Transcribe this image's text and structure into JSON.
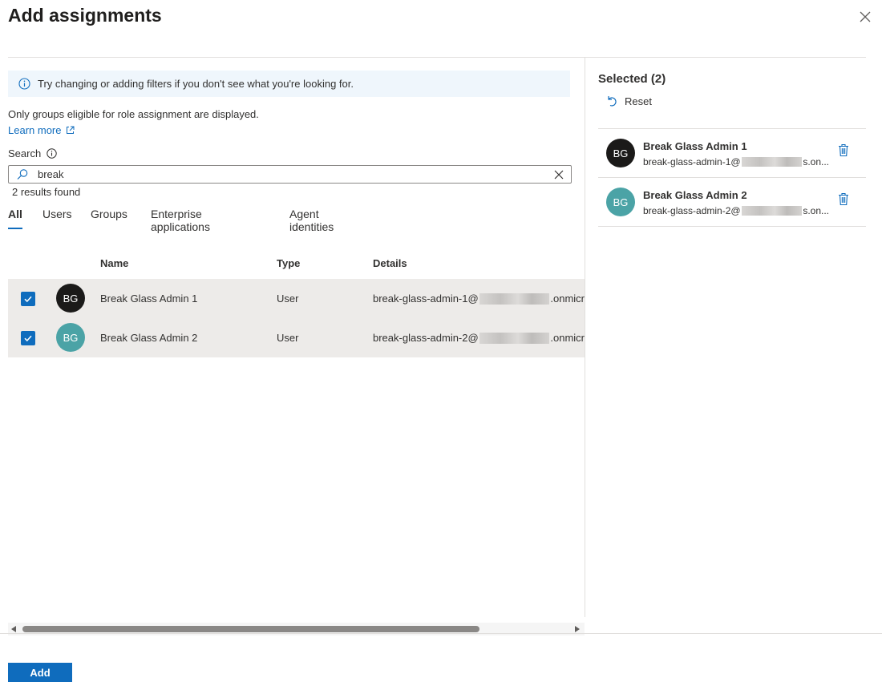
{
  "dialog": {
    "title": "Add assignments"
  },
  "info": {
    "message": "Try changing or adding filters if you don't see what you're looking for."
  },
  "notice": "Only groups eligible for role assignment are displayed.",
  "learn_more": "Learn more",
  "search": {
    "label": "Search",
    "value": "break",
    "results_text": "2 results found"
  },
  "tabs": [
    {
      "label": "All",
      "active": true
    },
    {
      "label": "Users",
      "active": false
    },
    {
      "label": "Groups",
      "active": false
    },
    {
      "label": "Enterprise applications",
      "active": false
    },
    {
      "label": "Agent identities",
      "active": false
    }
  ],
  "table": {
    "headers": {
      "name": "Name",
      "type": "Type",
      "details": "Details"
    },
    "rows": [
      {
        "checked": true,
        "initials": "BG",
        "avatar_color": "#1b1a19",
        "name": "Break Glass Admin 1",
        "type": "User",
        "details_prefix": "break-glass-admin-1@",
        "details_suffix": ".onmicr"
      },
      {
        "checked": true,
        "initials": "BG",
        "avatar_color": "#4ba3a6",
        "name": "Break Glass Admin 2",
        "type": "User",
        "details_prefix": "break-glass-admin-2@",
        "details_suffix": ".onmicr"
      }
    ]
  },
  "selected": {
    "title": "Selected (2)",
    "reset_label": "Reset",
    "items": [
      {
        "initials": "BG",
        "avatar_color": "#1b1a19",
        "name": "Break Glass Admin 1",
        "email_prefix": "break-glass-admin-1@",
        "email_suffix": "s.on..."
      },
      {
        "initials": "BG",
        "avatar_color": "#4ba3a6",
        "name": "Break Glass Admin 2",
        "email_prefix": "break-glass-admin-2@",
        "email_suffix": "s.on..."
      }
    ]
  },
  "footer": {
    "add_label": "Add"
  },
  "colors": {
    "accent": "#0f6cbd",
    "info_bg": "#eff6fc",
    "row_selected_bg": "#edebe9"
  }
}
